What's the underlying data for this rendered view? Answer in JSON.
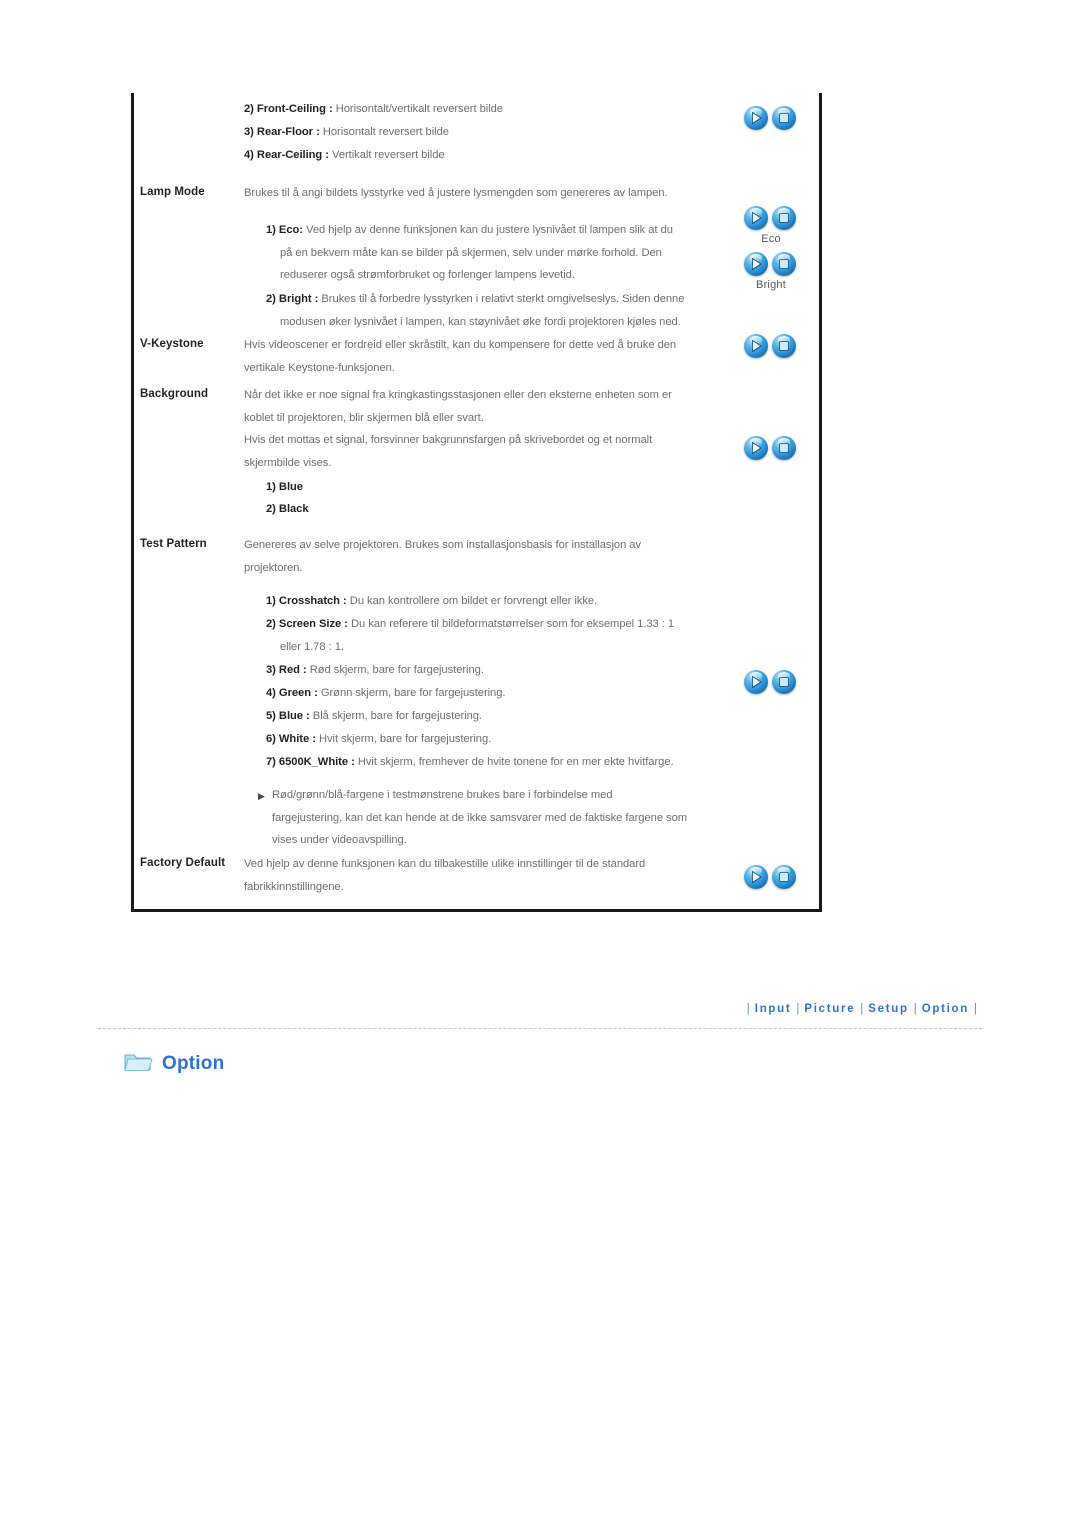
{
  "document": {
    "section_heading": {
      "icon": "folder-icon",
      "label": "Option"
    }
  },
  "content_box": {
    "top_list": [
      {
        "index": "2)",
        "name": "Front-Ceiling",
        "sep": ":",
        "desc": "Horisontalt/vertikalt reversert bilde"
      },
      {
        "index": "3)",
        "name": "Rear-Floor",
        "sep": ":",
        "desc": "Horisontalt reversert bilde"
      },
      {
        "index": "4)",
        "name": "Rear-Ceiling",
        "sep": ":",
        "desc": "Vertikalt reversert bilde"
      }
    ],
    "rows": [
      {
        "label": "Lamp Mode",
        "body": "Brukes til å angi bildets lysstyrke ved å justere lysmengden som genereres av lampen.",
        "sub_items": [
          {
            "index": "1)",
            "name": "Eco",
            "sep": ":",
            "desc": "Ved hjelp av denne funksjonen kan du justere lysnivået til lampen slik at du",
            "desc2": "på en bekvem måte kan se bilder på skjermen, selv under mørke forhold. Den",
            "desc3": "reduserer også strømforbruket og forlenger lampens levetid."
          },
          {
            "index": "2)",
            "name": "Bright",
            "sep": ":",
            "desc": "Brukes til å forbedre lysstyrken i relativt sterkt omgivelseslys. Siden denne",
            "desc2": "modusen øker lysnivået i lampen, kan støynivået øke fordi projektoren kjøles ned."
          }
        ]
      },
      {
        "label": "V-Keystone",
        "body": "Hvis videoscener er fordreid eller skråstilt, kan du kompensere for dette ved å bruke den",
        "body2": "vertikale Keystone-funksjonen."
      },
      {
        "label": "Background",
        "body": "Når det ikke er noe signal fra kringkastingsstasjonen eller den eksterne enheten som er",
        "body2": "koblet til projektoren, blir skjermen blå eller svart.",
        "body3": "Hvis det mottas et signal, forsvinner bakgrunnsfargen på skrivebordet og et normalt",
        "body4": "skjermbilde vises.",
        "sub_items": [
          {
            "index": "1)",
            "name": "Blue",
            "sep": "",
            "desc": ""
          },
          {
            "index": "2)",
            "name": "Black",
            "sep": "",
            "desc": ""
          }
        ]
      },
      {
        "label": "Test Pattern",
        "body": "Genereres av selve projektoren. Brukes som installasjonsbasis for installasjon av",
        "body2": "projektoren.",
        "sub_items": [
          {
            "index": "1)",
            "name": "Crosshatch",
            "sep": ":",
            "desc": "Du kan kontrollere om bildet er forvrengt eller ikke."
          },
          {
            "index": "2)",
            "name": "Screen Size",
            "sep": ":",
            "desc": "Du kan referere til bildeformatstørrelser som for eksempel 1.33 : 1",
            "desc2": "eller 1.78 : 1."
          },
          {
            "index": "3)",
            "name": "Red",
            "sep": ":",
            "desc": "Rød skjerm, bare for fargejustering."
          },
          {
            "index": "4)",
            "name": "Green",
            "sep": ":",
            "desc": "Grønn skjerm, bare for fargejustering."
          },
          {
            "index": "5)",
            "name": "Blue",
            "sep": ":",
            "desc": "Blå skjerm, bare for fargejustering."
          },
          {
            "index": "6)",
            "name": "White",
            "sep": ":",
            "desc": "Hvit skjerm, bare for fargejustering."
          },
          {
            "index": "7)",
            "name": "6500K_White",
            "sep": ":",
            "desc": "Hvit skjerm, fremhever de hvite tonene for en mer ekte hvitfarge."
          }
        ],
        "note": {
          "marker": "▶",
          "line1": "Rød/grønn/blå-fargene i testmønstrene brukes bare i forbindelse med",
          "line2": "fargejustering, kan det kan hende at de ikke samsvarer med de faktiske fargene som",
          "line3": "vises under videoavspilling."
        }
      },
      {
        "label": "Factory Default",
        "body": "Ved hjelp av denne funksjonen kan du tilbakestille ulike innstillinger til de standard",
        "body2": "fabrikkinnstillingene."
      }
    ],
    "icon_groups": [
      {
        "play": "play-sphere-icon",
        "stop": "stop-sphere-icon",
        "caption": ""
      },
      {
        "play": "play-sphere-icon",
        "stop": "stop-sphere-icon",
        "caption": "Eco"
      },
      {
        "play": "play-sphere-icon",
        "stop": "stop-sphere-icon",
        "caption": "Bright"
      },
      {
        "play": "play-sphere-icon",
        "stop": "stop-sphere-icon",
        "caption": ""
      },
      {
        "play": "play-sphere-icon",
        "stop": "stop-sphere-icon",
        "caption": ""
      },
      {
        "play": "play-sphere-icon",
        "stop": "stop-sphere-icon",
        "caption": ""
      },
      {
        "play": "play-sphere-icon",
        "stop": "stop-sphere-icon",
        "caption": ""
      }
    ]
  },
  "footer_nav": {
    "separator": "|",
    "items": [
      {
        "label": "Input"
      },
      {
        "label": "Picture"
      },
      {
        "label": "Setup"
      },
      {
        "label": "Option"
      }
    ]
  },
  "colors": {
    "link_blue": "#2f6fd0",
    "body_gray": "#6d6e71",
    "heading_dark": "#231f20",
    "sphere_blue": "#2a8fd4"
  }
}
